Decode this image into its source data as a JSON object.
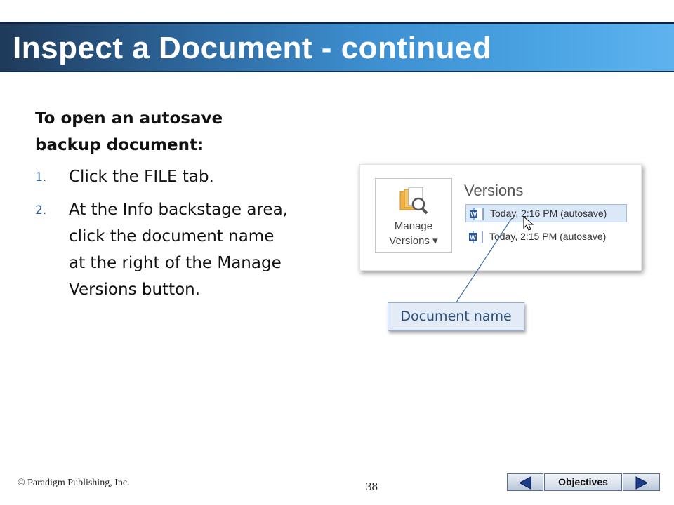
{
  "slide": {
    "title": "Inspect a Document - continued",
    "heading": "To open an autosave backup document:",
    "steps": [
      {
        "num": "1.",
        "text": "Click the FILE tab."
      },
      {
        "num": "2.",
        "text": "At the Info backstage area, click the document name at the right of the Manage Versions button."
      }
    ]
  },
  "screenshot": {
    "manage_versions_label_1": "Manage",
    "manage_versions_label_2": "Versions ▾",
    "versions_heading": "Versions",
    "version_rows": [
      {
        "text": "Today, 2:16 PM (autosave)",
        "selected": true
      },
      {
        "text": "Today, 2:15 PM (autosave)",
        "selected": false
      }
    ],
    "icons": [
      "manage-versions-icon",
      "word-doc-icon",
      "mouse-cursor-icon"
    ]
  },
  "callout": {
    "label": "Document name"
  },
  "footer": {
    "copyright": "© Paradigm Publishing, Inc.",
    "page_number": "38",
    "nav_label": "Objectives",
    "icons": [
      "prev-triangle-icon",
      "next-triangle-icon"
    ]
  },
  "colors": {
    "title_bar_dark": "#1f3a5a",
    "title_bar_light": "#5eb3ef",
    "selected_row": "#dbe8f7",
    "callout_bg": "#e2ebf6",
    "list_number": "#2a5f9a"
  }
}
